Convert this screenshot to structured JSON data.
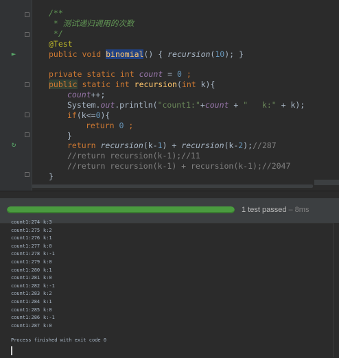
{
  "editor": {
    "lines": {
      "l1": "/**",
      "l2": " * 测试递归调用的次数",
      "l3": " */",
      "l4": "@Test",
      "l5_kw1": "public",
      "l5_kw2": " void ",
      "l5_name": "binomial",
      "l5_rest1": "() { ",
      "l5_call": "recursion",
      "l5_rest2": "(",
      "l5_num": "10",
      "l5_rest3": "); }",
      "l7_kw": "private static int ",
      "l7_fld": "count",
      "l7_mid": " = ",
      "l7_num": "0",
      "l7_end": " ;",
      "l8_pub": "public",
      "l8_kw": " static int ",
      "l8_name": "recursion",
      "l8_open": "(",
      "l8_kw2": "int",
      "l8_rest": " k){",
      "l9_fld": "count",
      "l9_end": "++;",
      "l10_a": "System.",
      "l10_out": "out",
      "l10_b": ".println(",
      "l10_str1": "\"count1:\"",
      "l10_c": "+",
      "l10_fld": "count",
      "l10_d": " + ",
      "l10_str2": "\"   k:\"",
      "l10_e": " + k);",
      "l11_kw": "if",
      "l11_a": "(k<=",
      "l11_num": "0",
      "l11_b": "){",
      "l12_kw": "return ",
      "l12_num": "0",
      "l12_end": " ;",
      "l13": "}",
      "l14_kw": "return ",
      "l14_c1": "recursion",
      "l14_a": "(k-",
      "l14_n1": "1",
      "l14_b": ") + ",
      "l14_c2": "recursion",
      "l14_c": "(k-",
      "l14_n2": "2",
      "l14_d": ");",
      "l14_cmt": "//287",
      "l15": "//return recursion(k-1);//11",
      "l16": "//return recursion(k-1) + recursion(k-1);//2047",
      "l17": "}"
    }
  },
  "run": {
    "progress_fraction": 1.0,
    "status": "1 test passed",
    "duration": " – 8ms",
    "console_rows": [
      {
        "count": "count1:274",
        "k": "k:3"
      },
      {
        "count": "count1:275",
        "k": "k:2"
      },
      {
        "count": "count1:276",
        "k": "k:1"
      },
      {
        "count": "count1:277",
        "k": "k:0"
      },
      {
        "count": "count1:278",
        "k": "k:-1"
      },
      {
        "count": "count1:279",
        "k": "k:0"
      },
      {
        "count": "count1:280",
        "k": "k:1"
      },
      {
        "count": "count1:281",
        "k": "k:0"
      },
      {
        "count": "count1:282",
        "k": "k:-1"
      },
      {
        "count": "count1:283",
        "k": "k:2"
      },
      {
        "count": "count1:284",
        "k": "k:1"
      },
      {
        "count": "count1:285",
        "k": "k:0"
      },
      {
        "count": "count1:286",
        "k": "k:-1"
      },
      {
        "count": "count1:287",
        "k": "k:0"
      }
    ],
    "exit_text": "Process finished with exit code 0"
  },
  "icons": {
    "run_test": "run-test-icon",
    "recursive_call": "recursive-call-icon"
  }
}
